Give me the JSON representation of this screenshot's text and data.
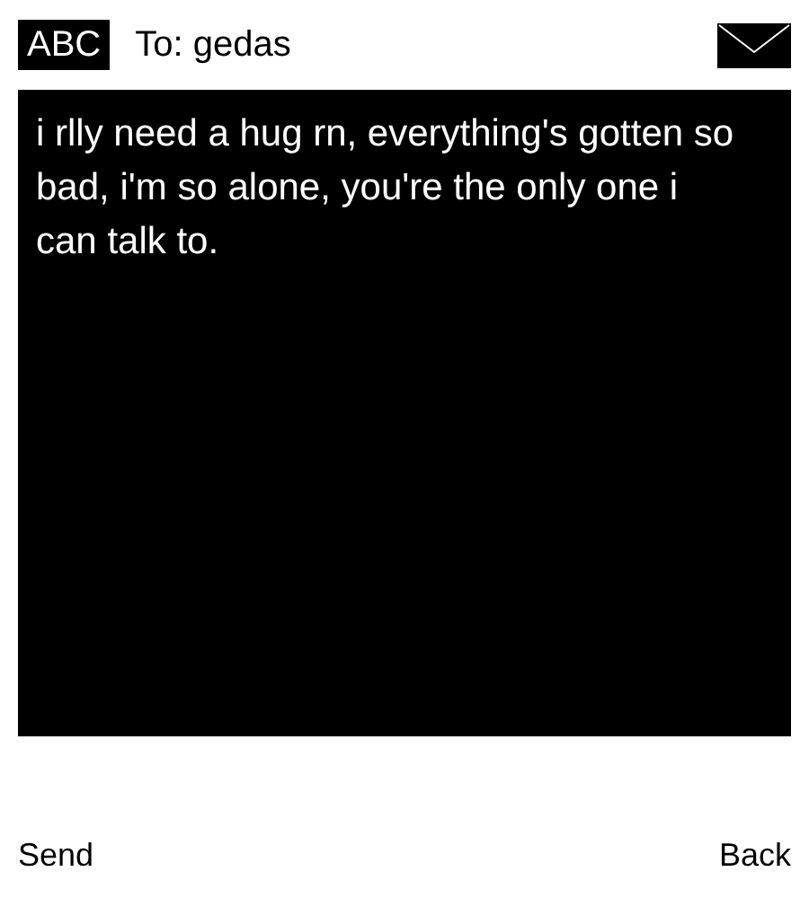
{
  "input_mode": "ABC",
  "recipient": "To: gedas",
  "message": "i rlly need a hug rn, everything's gotten so bad, i'm so alone, you're the only one i can talk to.",
  "softkeys": {
    "left": "Send",
    "right": "Back"
  }
}
